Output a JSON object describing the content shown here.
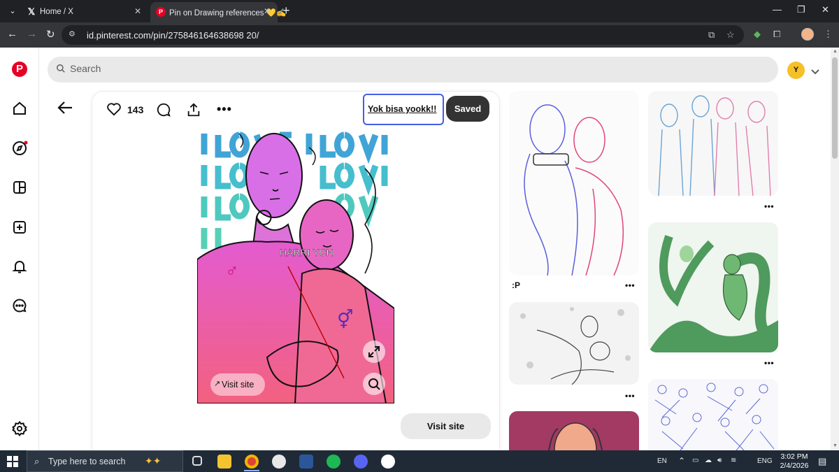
{
  "browser": {
    "tabs": [
      {
        "title": "Home / X",
        "favicon": "x-logo-icon",
        "active": false
      },
      {
        "title": "Pin on Drawing references 💛✍️",
        "favicon": "pinterest-icon",
        "active": true
      }
    ],
    "url": "id.pinterest.com/pin/275846164638698 20/"
  },
  "pinterest": {
    "search_placeholder": "Search",
    "avatar_initial": "Y",
    "like_count": "143",
    "board_name": "Yok bisa yookk!!",
    "saved_label": "Saved",
    "image_visit_label": "Visit site",
    "visit_site_label": "Visit site",
    "pin_overlay_text": "HARRI YCH",
    "related_caption_1": ":P",
    "accent": "#e60023"
  },
  "taskbar": {
    "search_placeholder": "Type here to search",
    "language": "EN",
    "input_lang": "ENG",
    "time": "3:02 PM",
    "date": "2/4/2026"
  }
}
